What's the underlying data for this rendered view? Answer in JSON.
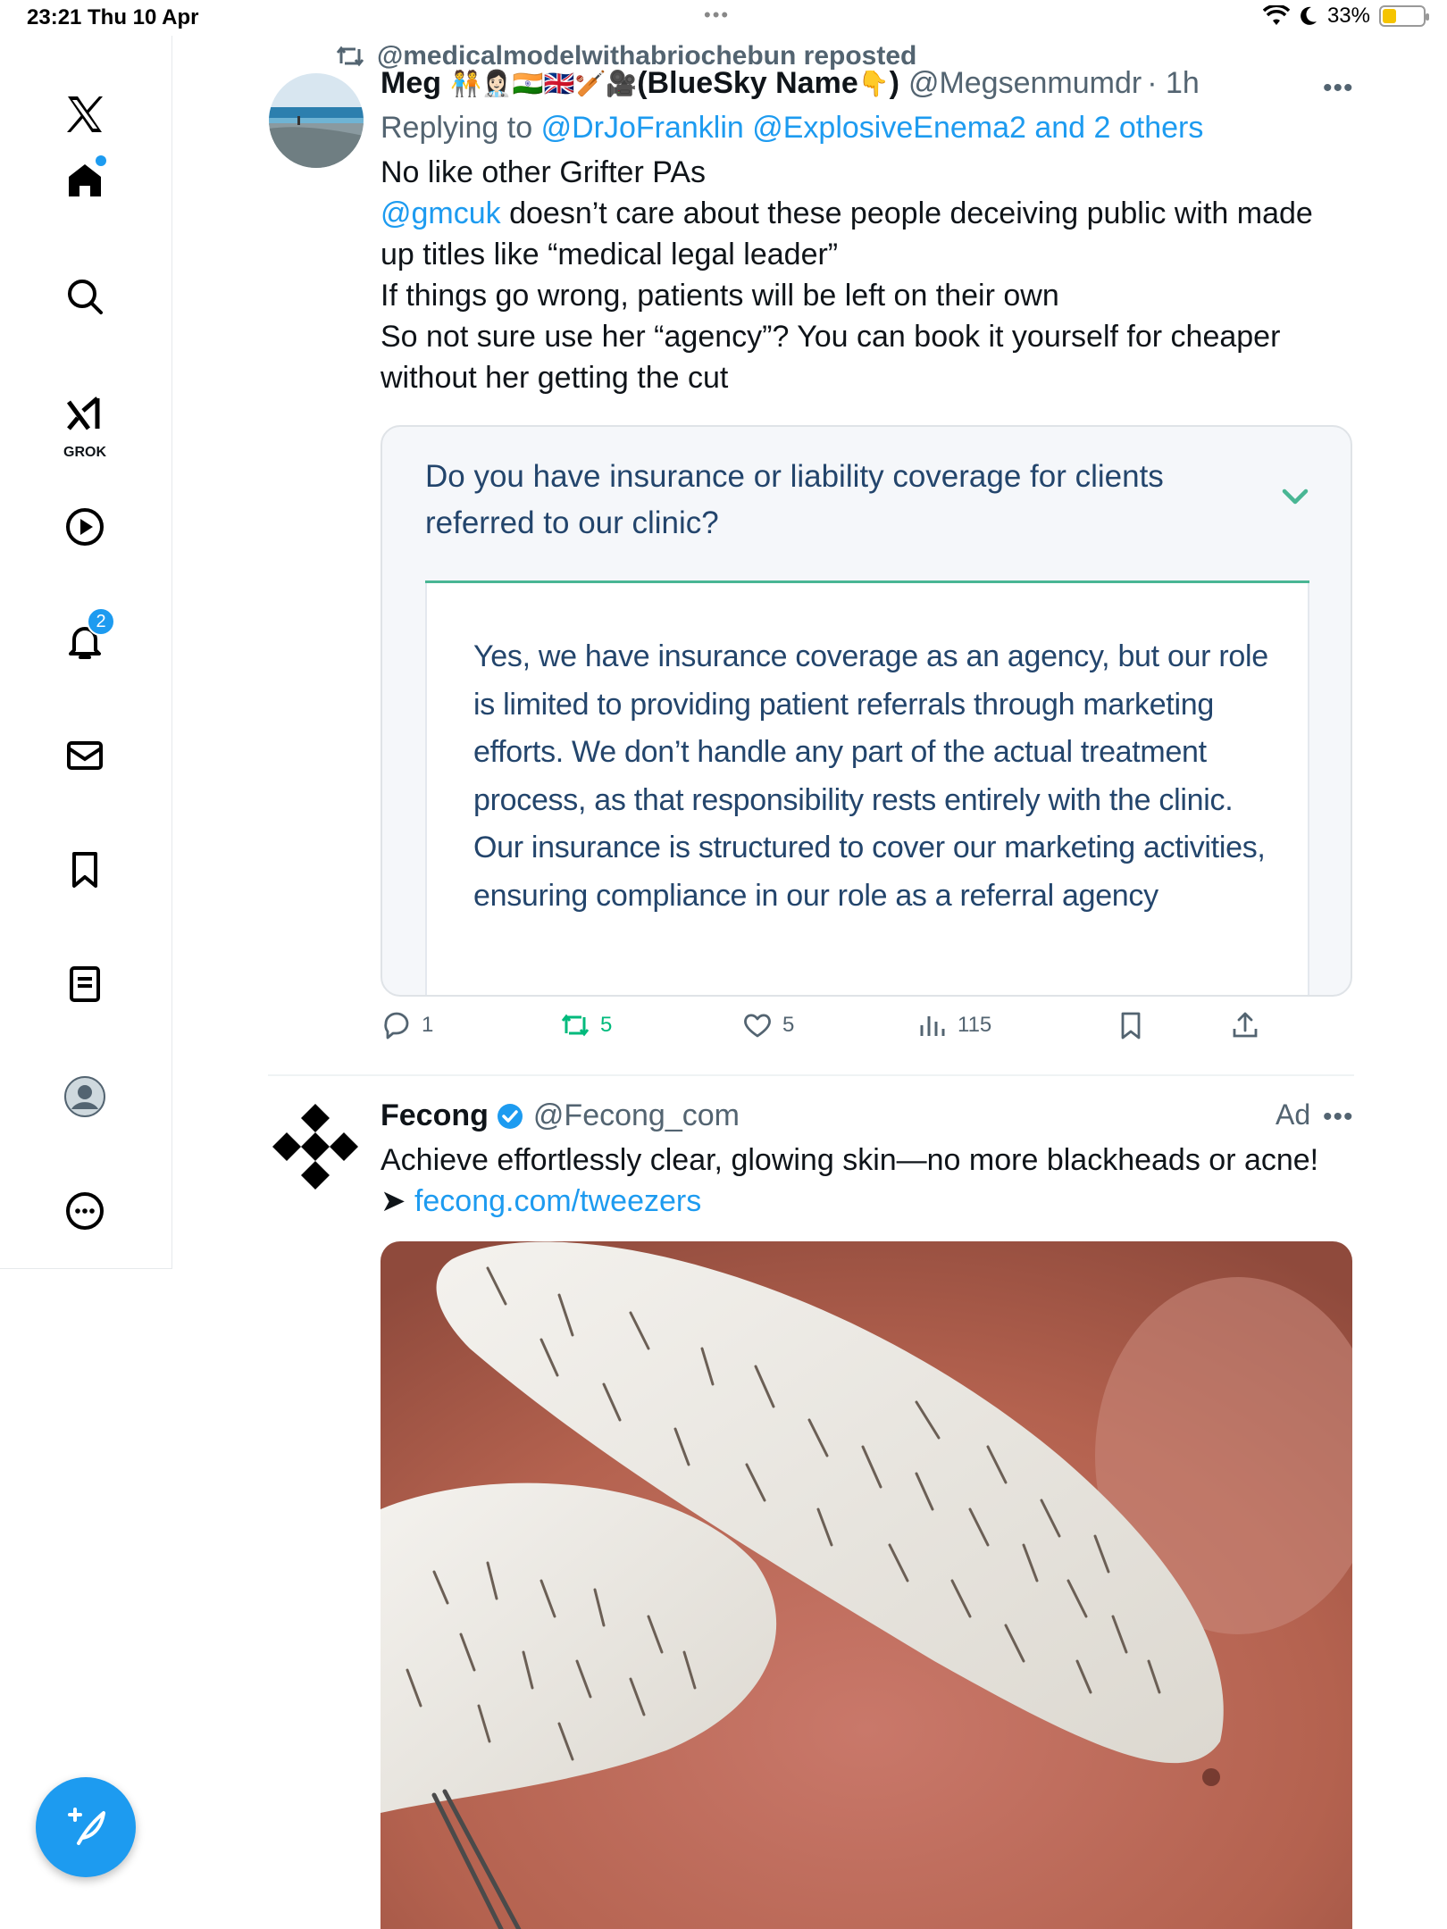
{
  "status_bar": {
    "time": "23:21",
    "date": "Thu 10 Apr",
    "battery_percent": "33%",
    "battery_level": 0.33
  },
  "sidebar": {
    "items": [
      {
        "name": "x-logo",
        "icon": "x-logo-icon"
      },
      {
        "name": "home",
        "icon": "home-icon",
        "has_dot": true
      },
      {
        "name": "explore",
        "icon": "search-icon"
      },
      {
        "name": "grok",
        "icon": "grok-icon",
        "label": "GROK"
      },
      {
        "name": "video",
        "icon": "play-icon"
      },
      {
        "name": "notifications",
        "icon": "bell-icon",
        "badge": "2"
      },
      {
        "name": "messages",
        "icon": "mail-icon"
      },
      {
        "name": "bookmarks",
        "icon": "bookmark-icon"
      },
      {
        "name": "lists",
        "icon": "list-icon"
      },
      {
        "name": "profile",
        "icon": "avatar-icon"
      },
      {
        "name": "more",
        "icon": "more-circle-icon"
      }
    ],
    "compose_icon": "compose-icon"
  },
  "tweet": {
    "repost_by": "@medicalmodelwithabriochebun reposted",
    "display_name": "Meg",
    "name_emojis": "🧑‍🤝‍🧑👩🏻‍⚕️🇮🇳🇬🇧🏏🎥",
    "name_suffix": "(BlueSky Name",
    "name_emoji_end": "👇",
    "name_close": ")",
    "handle": "@Megsenmumdr",
    "time": "· 1h",
    "reply_prefix": "Replying to",
    "reply_to": "@DrJoFranklin @ExplosiveEnema2 and 2 others",
    "text_line1": "No like other Grifter PAs",
    "mention": "@gmcuk",
    "text_after_mention": "doesn’t care about these people deceiving public with made up titles like “medical legal leader”",
    "text_line3": "If things go wrong, patients will be left on their own",
    "text_line4": "So not sure use her “agency”? You can book it yourself for cheaper without her getting the cut",
    "media": {
      "question": "Do you have insurance or liability coverage for clients referred to our clinic?",
      "answer": "Yes, we have insurance coverage as an agency, but our role is limited to providing patient referrals through marketing efforts. We don’t handle any part of the actual treatment process, as that responsibility rests entirely with the clinic. Our insurance is structured to cover our marketing activities, ensuring compliance in our role as a referral agency",
      "accent": "#49b694",
      "text_color": "#23456c"
    },
    "actions": {
      "replies": "1",
      "reposts": "5",
      "likes": "5",
      "views": "115"
    }
  },
  "ad": {
    "display_name": "Fecong",
    "handle": "@Fecong_com",
    "label": "Ad",
    "text": "Achieve effortlessly clear, glowing skin—no more blackheads or acne!",
    "arrow": "➤",
    "link": "fecong.com/tweezers"
  },
  "colors": {
    "link": "#1d9bf0",
    "muted": "#536471",
    "repost_green": "#00ba7c"
  }
}
